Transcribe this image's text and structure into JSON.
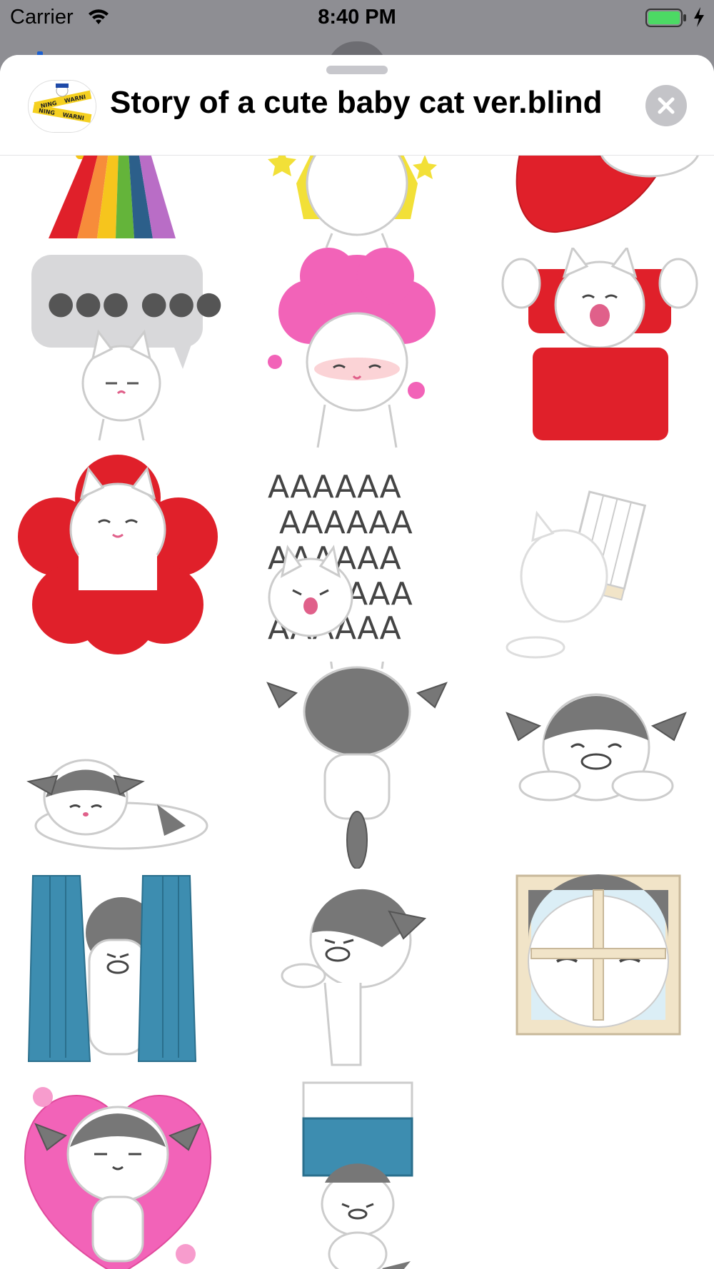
{
  "status_bar": {
    "carrier": "Carrier",
    "time": "8:40 PM",
    "battery_color": "#4cd964"
  },
  "sheet": {
    "title": "Story of a cute baby cat ver.blind",
    "icon_lines": [
      "NING",
      "WARNI",
      "NING",
      "WARNI"
    ],
    "close_icon": "close-icon"
  },
  "stickers": [
    {
      "name": "sticker-rainbow"
    },
    {
      "name": "sticker-cat-sparkle"
    },
    {
      "name": "sticker-red-heart"
    },
    {
      "name": "sticker-speech-bubble-cat",
      "text": "●●● ●●●."
    },
    {
      "name": "sticker-pink-afro-cat"
    },
    {
      "name": "sticker-cat-red-sofa"
    },
    {
      "name": "sticker-cat-red-flower"
    },
    {
      "name": "sticker-screaming-cat",
      "text": "AAAAAA"
    },
    {
      "name": "sticker-cat-blind-curtain"
    },
    {
      "name": "sticker-cat-lying-down"
    },
    {
      "name": "sticker-cat-back-view"
    },
    {
      "name": "sticker-cat-peeking-grin"
    },
    {
      "name": "sticker-cat-between-curtains"
    },
    {
      "name": "sticker-cat-peeking-side"
    },
    {
      "name": "sticker-cat-window"
    },
    {
      "name": "sticker-cat-pink-heart"
    },
    {
      "name": "sticker-cat-holding-box"
    }
  ]
}
